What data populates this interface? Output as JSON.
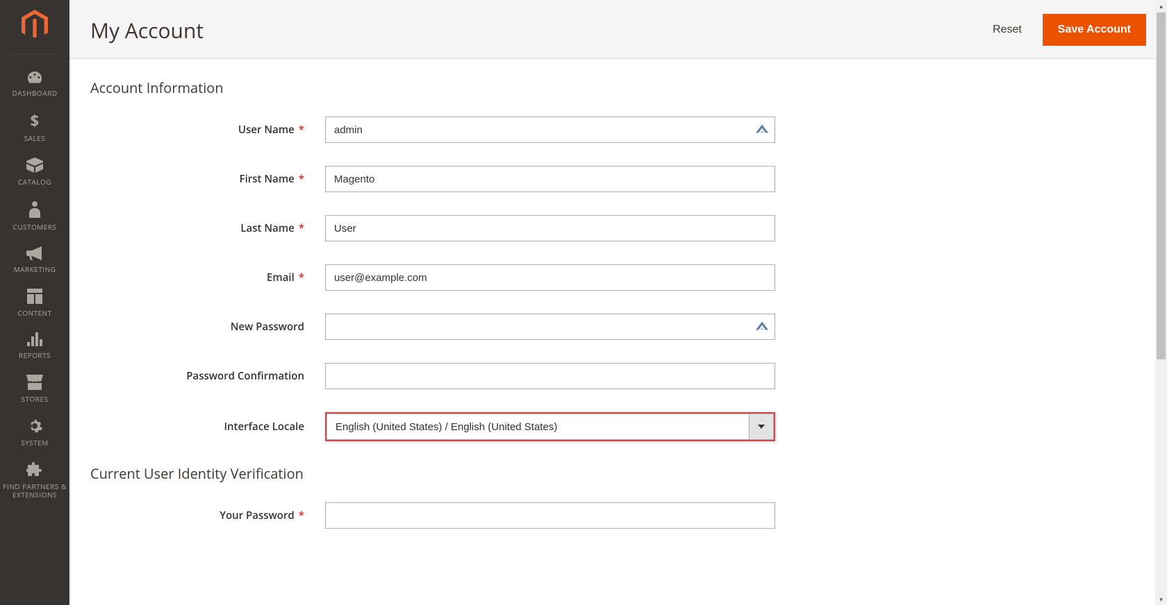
{
  "sidebar": {
    "items": [
      {
        "label": "DASHBOARD"
      },
      {
        "label": "SALES"
      },
      {
        "label": "CATALOG"
      },
      {
        "label": "CUSTOMERS"
      },
      {
        "label": "MARKETING"
      },
      {
        "label": "CONTENT"
      },
      {
        "label": "REPORTS"
      },
      {
        "label": "STORES"
      },
      {
        "label": "SYSTEM"
      },
      {
        "label": "FIND PARTNERS & EXTENSIONS"
      }
    ]
  },
  "header": {
    "title": "My Account",
    "reset_label": "Reset",
    "save_label": "Save Account"
  },
  "sections": {
    "account_info_title": "Account Information",
    "verification_title": "Current User Identity Verification"
  },
  "fields": {
    "username": {
      "label": "User Name",
      "value": "admin"
    },
    "firstname": {
      "label": "First Name",
      "value": "Magento"
    },
    "lastname": {
      "label": "Last Name",
      "value": "User"
    },
    "email": {
      "label": "Email",
      "value": "user@example.com"
    },
    "new_password": {
      "label": "New Password",
      "value": ""
    },
    "password_confirm": {
      "label": "Password Confirmation",
      "value": ""
    },
    "locale": {
      "label": "Interface Locale",
      "value": "English (United States) / English (United States)"
    },
    "your_password": {
      "label": "Your Password",
      "value": ""
    }
  },
  "required_mark": "*"
}
